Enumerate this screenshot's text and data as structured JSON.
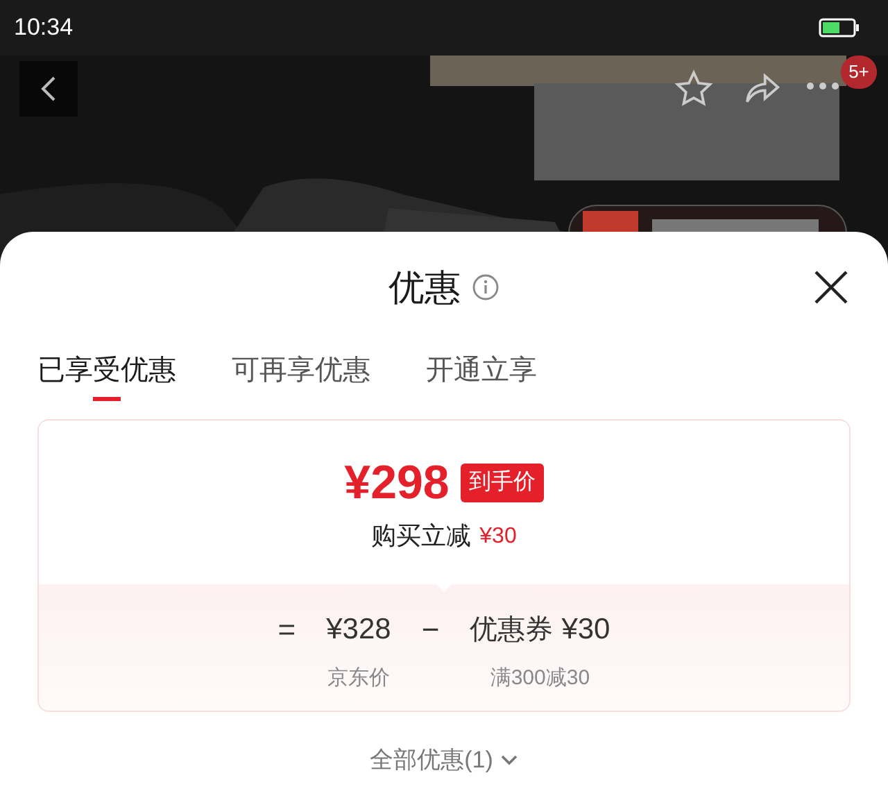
{
  "status_bar": {
    "time": "10:34"
  },
  "header": {
    "badge": "5+"
  },
  "sheet": {
    "title": "优惠",
    "tabs": [
      {
        "label": "已享受优惠",
        "selected": true
      },
      {
        "label": "可再享优惠",
        "selected": false
      },
      {
        "label": "开通立享",
        "selected": false
      }
    ],
    "card": {
      "final_price": "¥298",
      "price_tag": "到手价",
      "discount_label": "购买立减",
      "discount_amount": "¥30",
      "formula": {
        "equals": "=",
        "base_price": "¥328",
        "minus": "−",
        "coupon_label": "优惠券",
        "coupon_amount": "¥30",
        "base_caption": "京东价",
        "coupon_caption": "满300减30"
      }
    },
    "footer_link": "全部优惠(1)"
  }
}
